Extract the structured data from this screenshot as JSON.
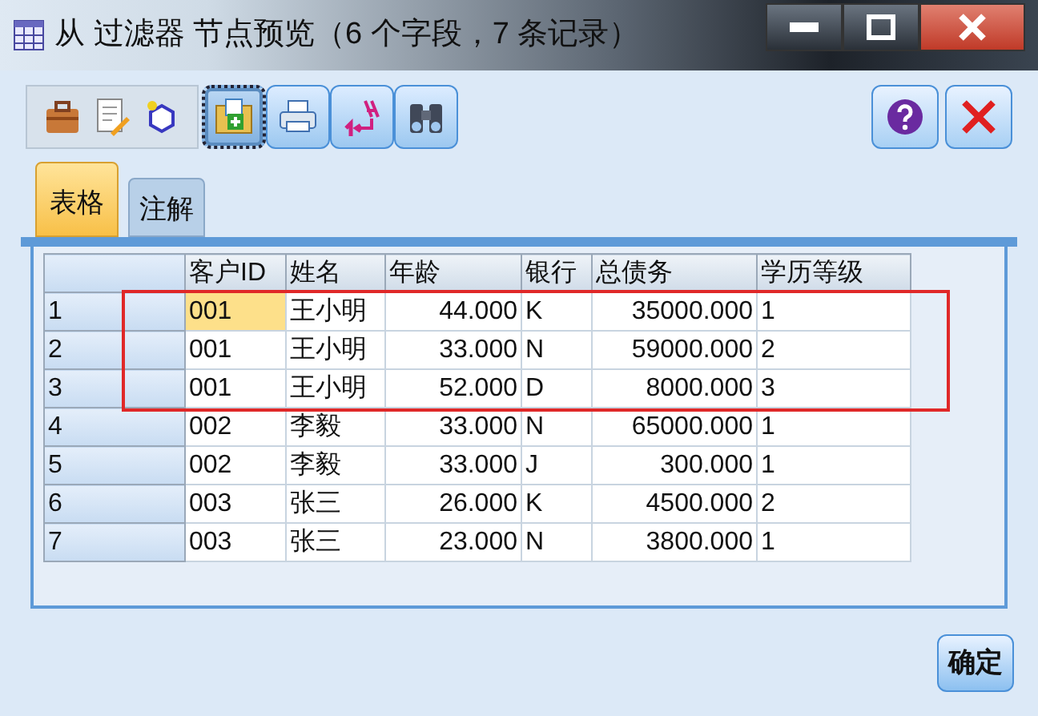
{
  "window": {
    "title": "从 过滤器 节点预览（6 个字段，7 条记录）"
  },
  "toolbar": {
    "left_tools": [
      {
        "kind": "briefcase"
      },
      {
        "kind": "document"
      },
      {
        "kind": "hexagon"
      }
    ],
    "tools": [
      {
        "kind": "export",
        "selected": true
      },
      {
        "kind": "print",
        "selected": false
      },
      {
        "kind": "sort",
        "selected": false
      },
      {
        "kind": "binoculars",
        "selected": false
      }
    ],
    "right_tools": [
      {
        "kind": "help"
      },
      {
        "kind": "close"
      }
    ]
  },
  "tabs": [
    {
      "label": "表格",
      "selected": true
    },
    {
      "label": "注解",
      "selected": false
    }
  ],
  "table": {
    "columns": [
      "客户ID",
      "姓名",
      "年龄",
      "银行",
      "总债务",
      "学历等级"
    ],
    "rows": [
      {
        "index": "1",
        "cells": [
          "001",
          "王小明",
          "44.000",
          "K",
          "35000.000",
          "1"
        ],
        "selected": true,
        "highlighted": true
      },
      {
        "index": "2",
        "cells": [
          "001",
          "王小明",
          "33.000",
          "N",
          "59000.000",
          "2"
        ],
        "selected": false,
        "highlighted": true
      },
      {
        "index": "3",
        "cells": [
          "001",
          "王小明",
          "52.000",
          "D",
          "8000.000",
          "3"
        ],
        "selected": false,
        "highlighted": true
      },
      {
        "index": "4",
        "cells": [
          "002",
          "李毅",
          "33.000",
          "N",
          "65000.000",
          "1"
        ],
        "selected": false,
        "highlighted": false
      },
      {
        "index": "5",
        "cells": [
          "002",
          "李毅",
          "33.000",
          "J",
          "300.000",
          "1"
        ],
        "selected": false,
        "highlighted": false
      },
      {
        "index": "6",
        "cells": [
          "003",
          "张三",
          "26.000",
          "K",
          "4500.000",
          "2"
        ],
        "selected": false,
        "highlighted": false
      },
      {
        "index": "7",
        "cells": [
          "003",
          "张三",
          "23.000",
          "N",
          "3800.000",
          "1"
        ],
        "selected": false,
        "highlighted": false
      }
    ]
  },
  "buttons": [
    {
      "label": "确定"
    }
  ]
}
